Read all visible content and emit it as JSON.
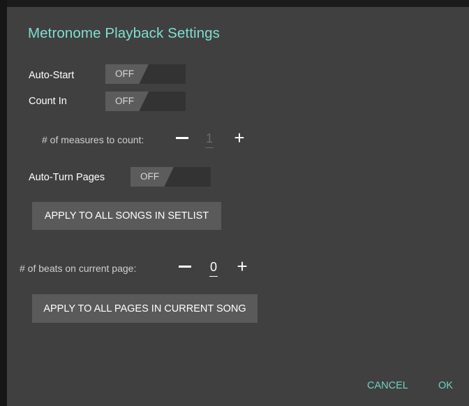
{
  "dialog": {
    "title": "Metronome Playback Settings"
  },
  "settings": {
    "auto_start": {
      "label": "Auto-Start",
      "state": "OFF"
    },
    "count_in": {
      "label": "Count In",
      "state": "OFF"
    },
    "measures": {
      "label": "# of measures to count:",
      "value": "1"
    },
    "auto_turn": {
      "label": "Auto-Turn Pages",
      "state": "OFF"
    },
    "apply_setlist_label": "APPLY TO ALL SONGS IN SETLIST",
    "beats": {
      "label": "# of beats on current page:",
      "value": "0"
    },
    "apply_song_label": "APPLY TO ALL PAGES IN CURRENT SONG"
  },
  "icons": {
    "minus": "minus-icon",
    "plus": "+"
  },
  "footer": {
    "cancel_label": "CANCEL",
    "ok_label": "OK"
  },
  "colors": {
    "accent": "#7fdfd0",
    "dialog_bg": "#404040",
    "button_bg": "#5a5a5a"
  }
}
